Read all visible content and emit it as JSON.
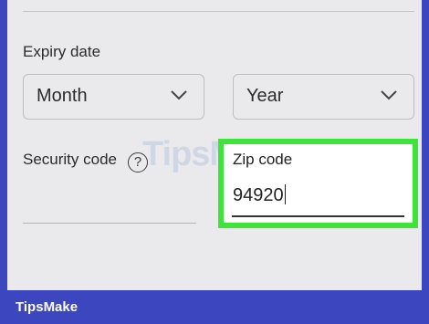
{
  "expiry": {
    "label": "Expiry date",
    "month": {
      "value": "Month",
      "icon": "chevron-down-icon"
    },
    "year": {
      "value": "Year",
      "icon": "chevron-down-icon"
    }
  },
  "security": {
    "label": "Security code",
    "help_icon": "help-circle-icon",
    "help_glyph": "?"
  },
  "zip": {
    "label": "Zip code",
    "value": "94920",
    "highlight_color": "#3fe43a"
  },
  "watermark": "TipsMake",
  "footer": {
    "brand": "TipsMake",
    "background": "#3c46bf"
  }
}
